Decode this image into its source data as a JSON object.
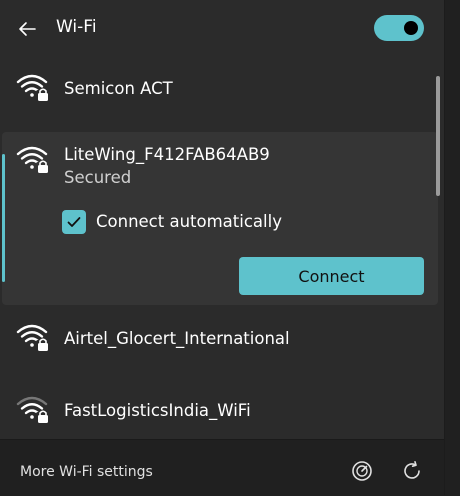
{
  "header": {
    "title": "Wi-Fi",
    "toggle_on": true
  },
  "networks": [
    {
      "name": "Semicon ACT",
      "secured": true
    },
    {
      "name": "LiteWing_F412FAB64AB9",
      "status": "Secured",
      "secured": true,
      "expanded": true,
      "connect_automatically_label": "Connect automatically",
      "connect_automatically_checked": true,
      "connect_label": "Connect"
    },
    {
      "name": "Airtel_Glocert_International",
      "secured": true
    },
    {
      "name": "FastLogisticsIndia_WiFi",
      "secured": true
    }
  ],
  "footer": {
    "more_settings_label": "More Wi-Fi settings"
  },
  "colors": {
    "accent": "#5ec2cc",
    "panel_bg": "#2b2b2b",
    "selected_bg": "#353535"
  }
}
